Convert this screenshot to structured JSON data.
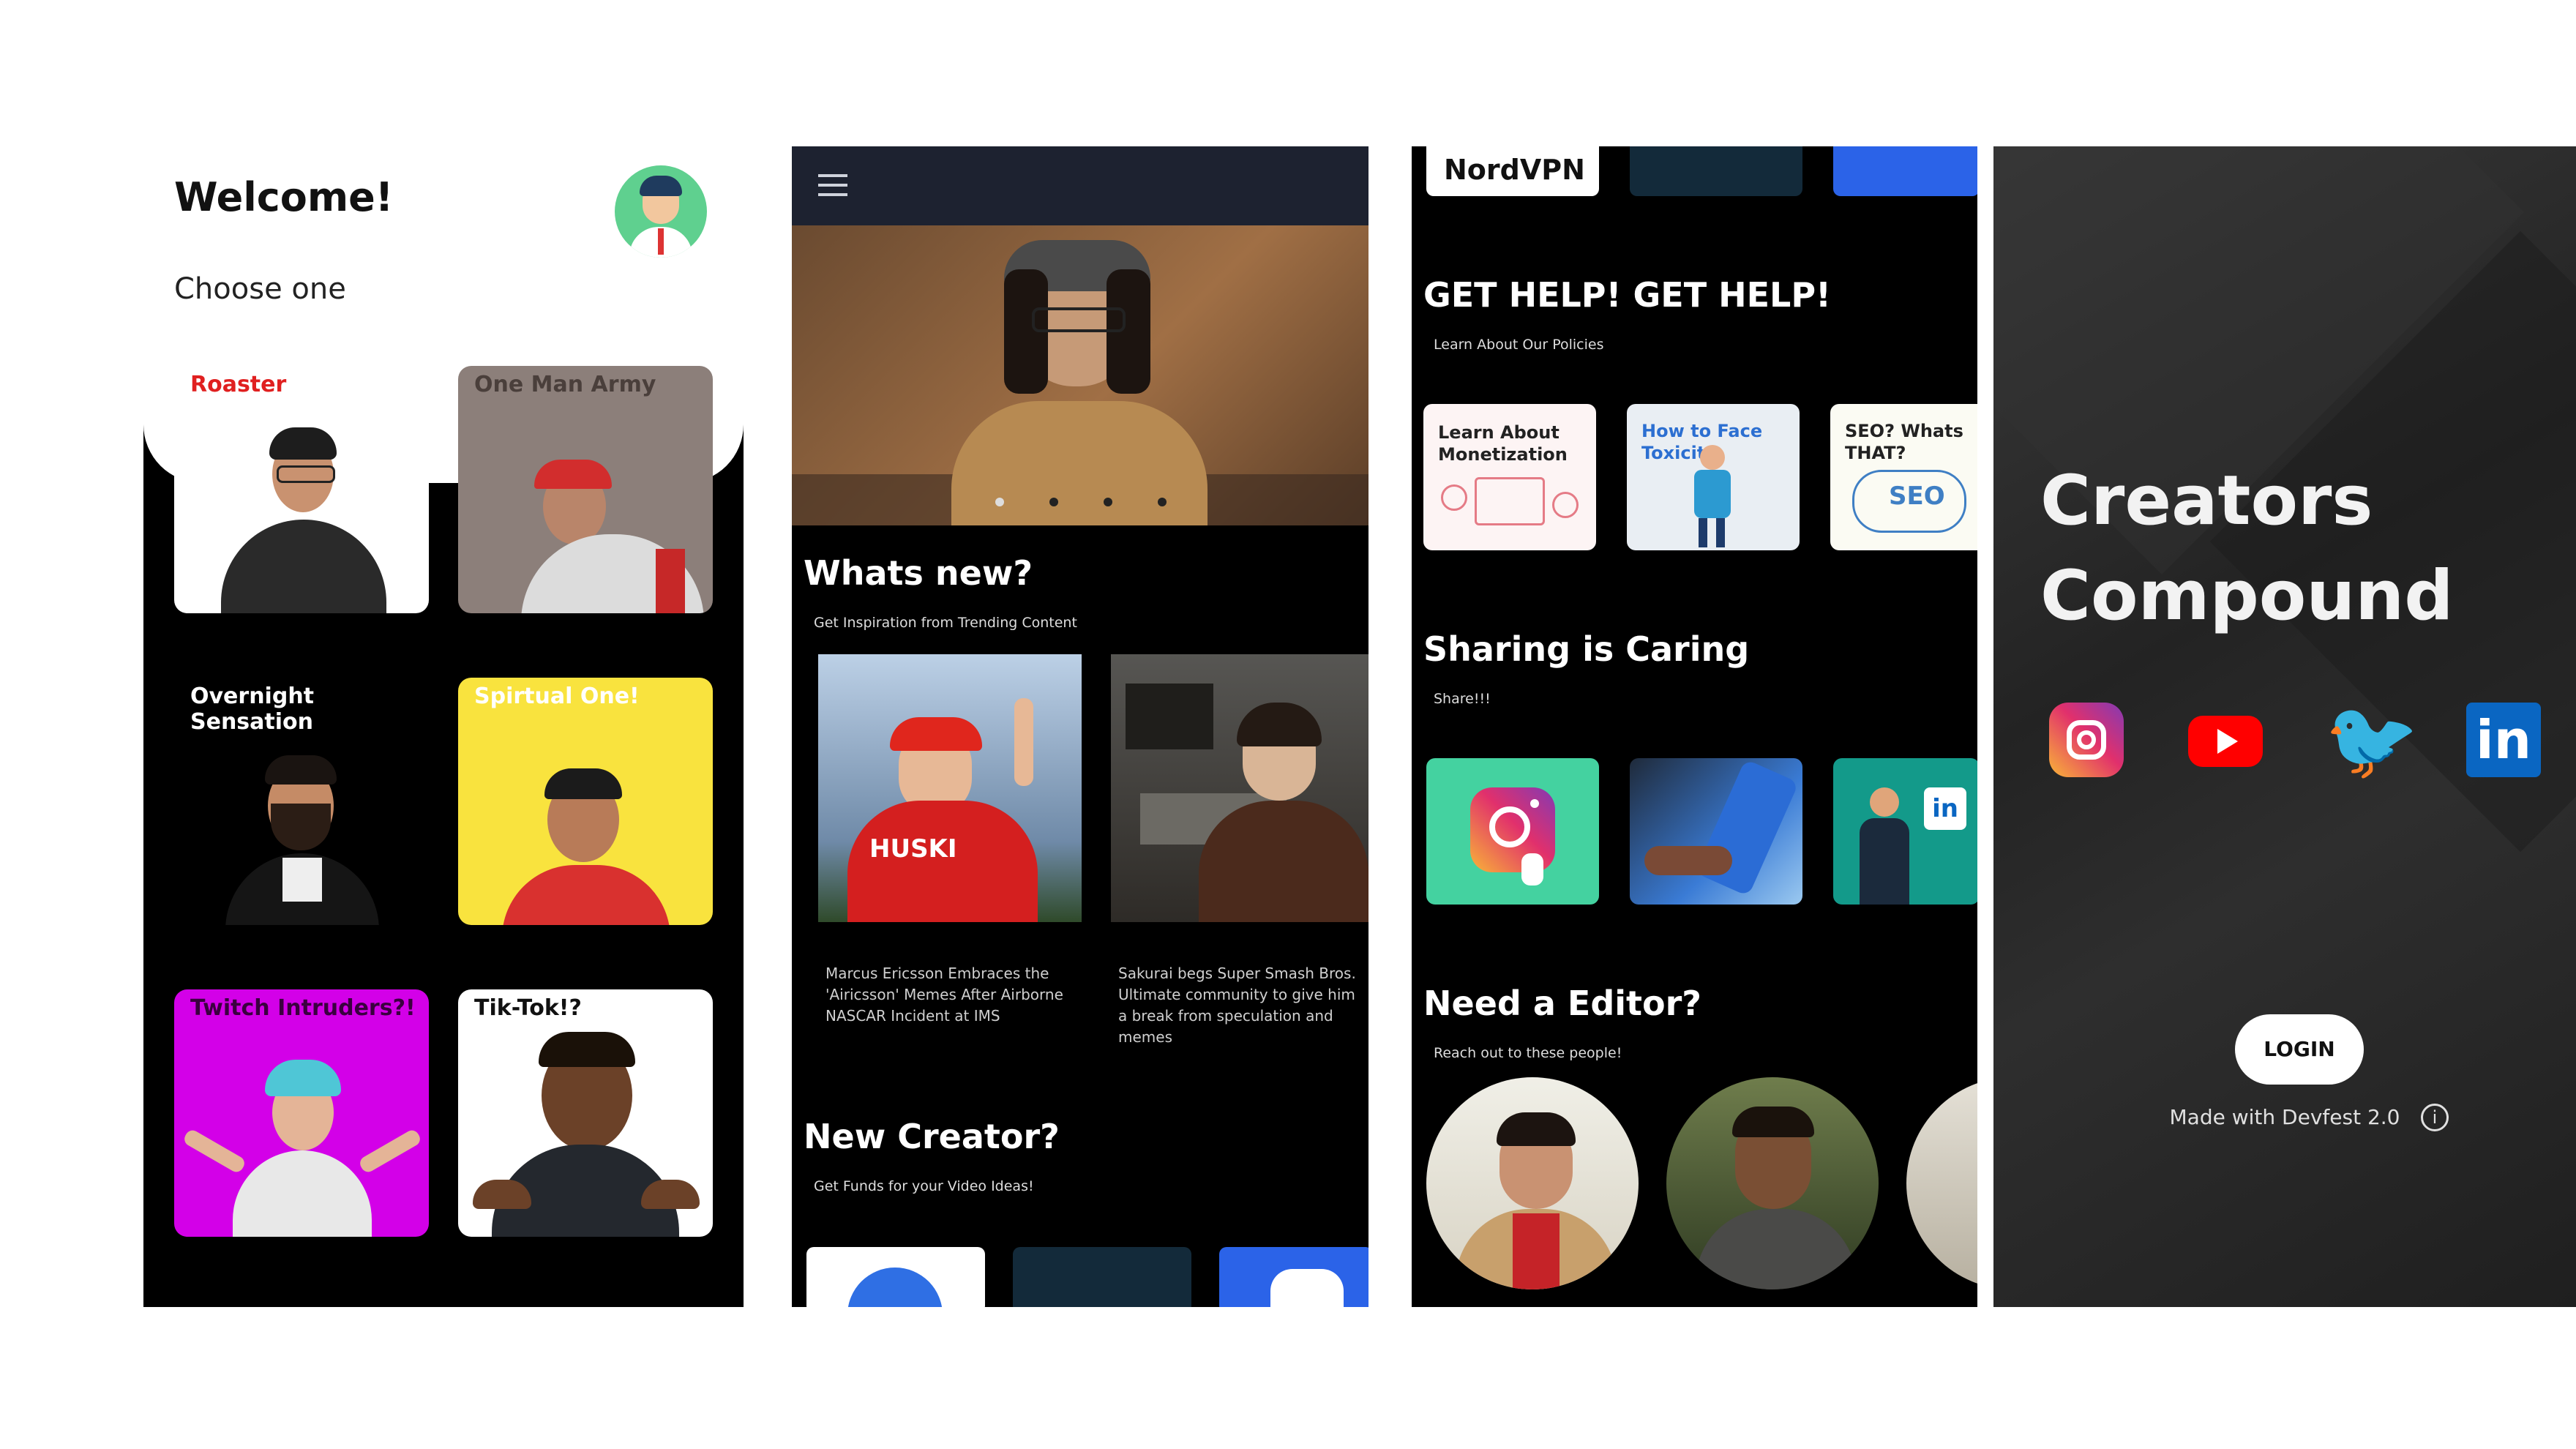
{
  "screen1": {
    "title": "Welcome!",
    "subtitle": "Choose one",
    "cards": [
      {
        "label": "Roaster",
        "bg": "#ffffff",
        "color": "#e02020"
      },
      {
        "label": "One Man Army",
        "bg": "#8c7f7a",
        "color": "#4a3f3b"
      },
      {
        "label": "Overnight Sensation",
        "bg": "#000000",
        "color": "#ffffff"
      },
      {
        "label": "Spirtual One!",
        "bg": "#f9e33e",
        "color": "#ffffff"
      },
      {
        "label": "Twitch Intruders?!",
        "bg": "#d300e8",
        "color": "#3a003f"
      },
      {
        "label": "Tik-Tok!?",
        "bg": "#ffffff",
        "color": "#111111"
      }
    ]
  },
  "screen2": {
    "whats_new": {
      "title": "Whats new?",
      "subtitle": "Get Inspiration from Trending Content"
    },
    "articles": [
      {
        "caption": "Marcus Ericsson Embraces the 'Airicsson' Memes After Airborne NASCAR Incident at IMS",
        "brand": "HUSKI"
      },
      {
        "caption": "Sakurai begs Super Smash Bros. Ultimate community to give him a break from speculation and memes"
      }
    ],
    "new_creator": {
      "title": "New Creator?",
      "subtitle": "Get Funds for your Video Ideas!"
    }
  },
  "screen3": {
    "top_brand": "NordVPN",
    "get_help": {
      "title": "GET HELP! GET HELP!",
      "subtitle": "Learn About Our Policies"
    },
    "help_cards": [
      "Learn About Monetization",
      "How to Face Toxicity",
      "SEO? Whats THAT?"
    ],
    "sharing": {
      "title": "Sharing is Caring",
      "subtitle": "Share!!!"
    },
    "editor": {
      "title": "Need a Editor?",
      "subtitle": "Reach out to these people!"
    }
  },
  "screen4": {
    "title_line1": "Creators",
    "title_line2": "Compound",
    "login_label": "LOGIN",
    "footer": "Made with Devfest 2.0",
    "footer_icon": "info-icon"
  },
  "colors": {
    "instagram": "#e1306c",
    "youtube": "#ff0000",
    "twitter": "#1da1f2",
    "linkedin": "#0a66c2"
  }
}
